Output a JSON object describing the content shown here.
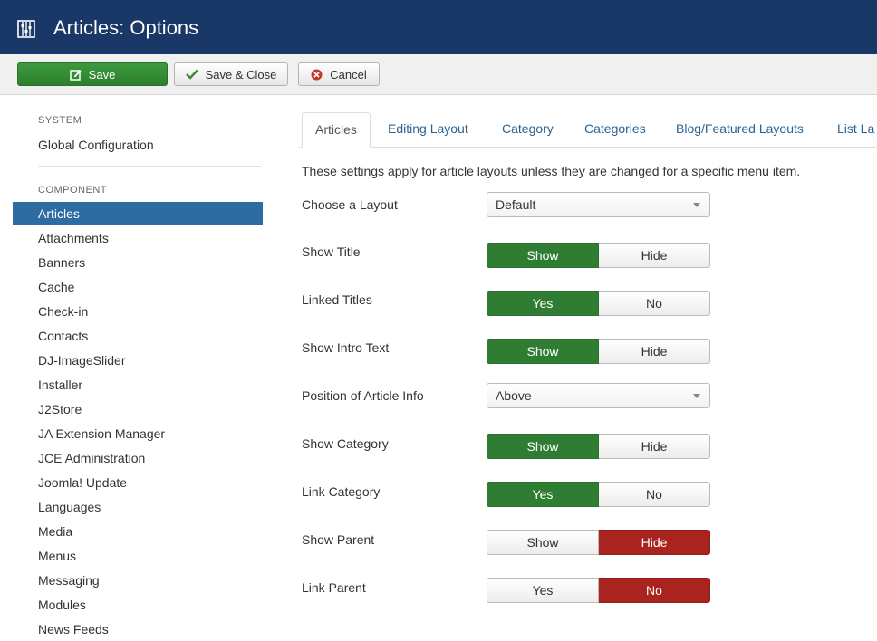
{
  "header": {
    "title": "Articles: Options",
    "icon": "options-grid-icon"
  },
  "toolbar": {
    "save_label": "Save",
    "save_close_label": "Save & Close",
    "cancel_label": "Cancel"
  },
  "sidebar": {
    "system_heading": "SYSTEM",
    "global_config": "Global Configuration",
    "component_heading": "COMPONENT",
    "items": [
      {
        "label": "Articles",
        "active": true
      },
      {
        "label": "Attachments"
      },
      {
        "label": "Banners"
      },
      {
        "label": "Cache"
      },
      {
        "label": "Check-in"
      },
      {
        "label": "Contacts"
      },
      {
        "label": "DJ-ImageSlider"
      },
      {
        "label": "Installer"
      },
      {
        "label": "J2Store"
      },
      {
        "label": "JA Extension Manager"
      },
      {
        "label": "JCE Administration"
      },
      {
        "label": "Joomla! Update"
      },
      {
        "label": "Languages"
      },
      {
        "label": "Media"
      },
      {
        "label": "Menus"
      },
      {
        "label": "Messaging"
      },
      {
        "label": "Modules"
      },
      {
        "label": "News Feeds"
      }
    ]
  },
  "tabs": [
    {
      "label": "Articles",
      "active": true
    },
    {
      "label": "Editing Layout"
    },
    {
      "label": "Category"
    },
    {
      "label": "Categories"
    },
    {
      "label": "Blog/Featured Layouts"
    },
    {
      "label": "List La"
    }
  ],
  "description": "These settings apply for article layouts unless they are changed for a specific menu item.",
  "fields": {
    "layout": {
      "label": "Choose a Layout",
      "value": "Default"
    },
    "show_title": {
      "label": "Show Title",
      "on": "Show",
      "off": "Hide",
      "selected": "Show"
    },
    "linked_titles": {
      "label": "Linked Titles",
      "on": "Yes",
      "off": "No",
      "selected": "Yes"
    },
    "show_intro": {
      "label": "Show Intro Text",
      "on": "Show",
      "off": "Hide",
      "selected": "Show"
    },
    "article_info": {
      "label": "Position of Article Info",
      "value": "Above"
    },
    "show_category": {
      "label": "Show Category",
      "on": "Show",
      "off": "Hide",
      "selected": "Show"
    },
    "link_category": {
      "label": "Link Category",
      "on": "Yes",
      "off": "No",
      "selected": "Yes"
    },
    "show_parent": {
      "label": "Show Parent",
      "on": "Show",
      "off": "Hide",
      "selected": "Hide"
    },
    "link_parent": {
      "label": "Link Parent",
      "on": "Yes",
      "off": "No",
      "selected": "No"
    }
  },
  "colors": {
    "header_bg": "#1a3867",
    "toggle_on_green": "#2f7d32",
    "toggle_on_red": "#a9231f",
    "active_sidebar": "#2d6ca2"
  }
}
